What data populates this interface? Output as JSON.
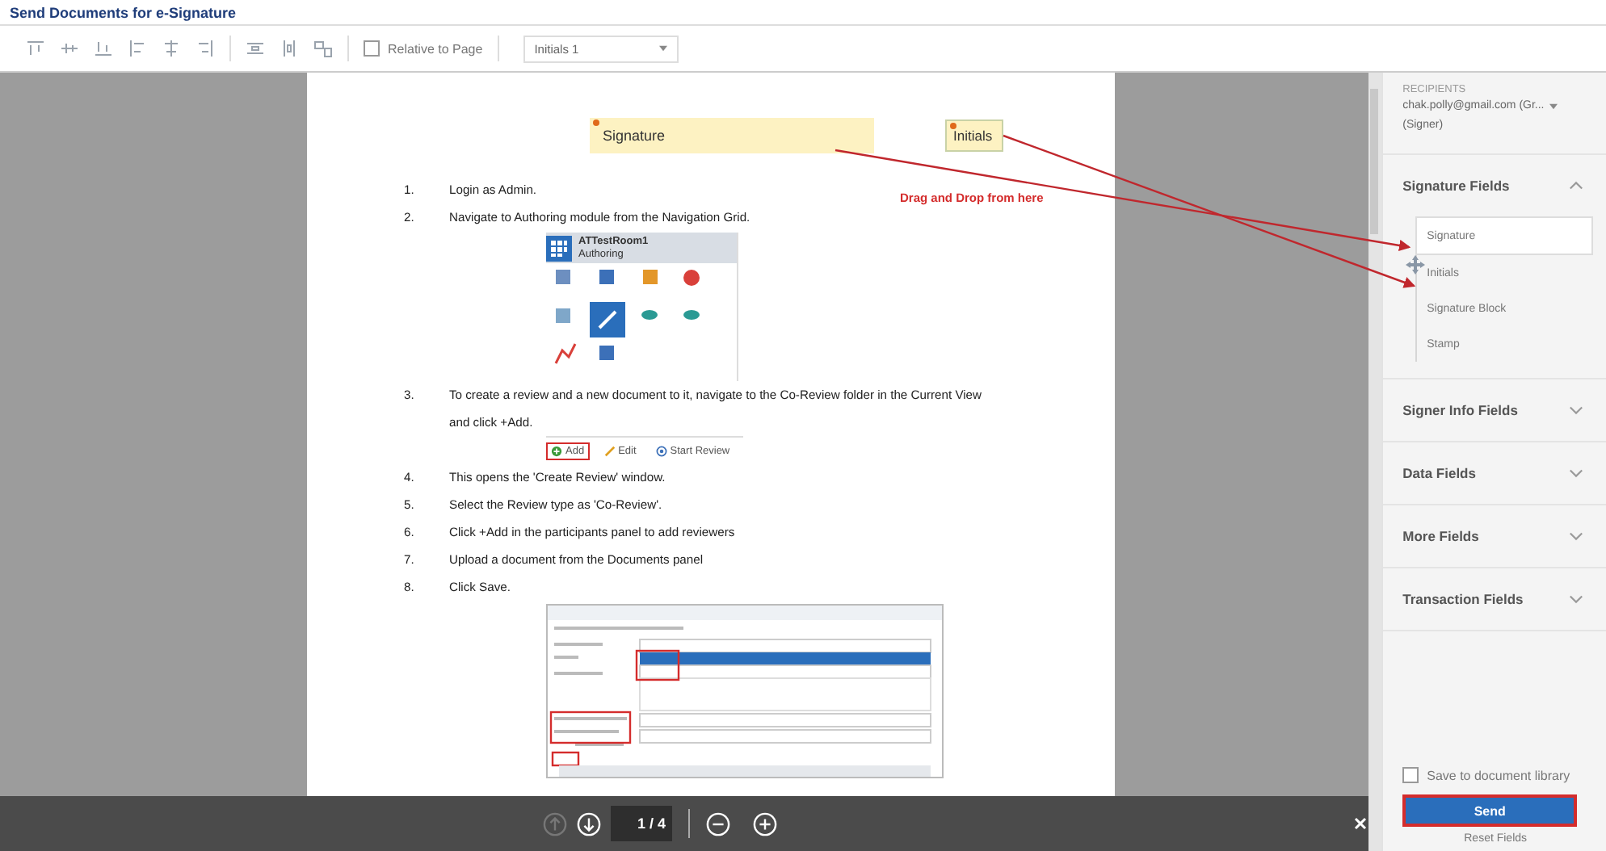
{
  "window": {
    "title": "Send Documents for e-Signature"
  },
  "toolbar": {
    "relative_to_page": {
      "label": "Relative to Page",
      "checked": false
    },
    "field_select": {
      "value": "Initials 1"
    }
  },
  "document": {
    "fields": [
      {
        "kind": "signature",
        "label": "Signature"
      },
      {
        "kind": "initials",
        "label": "Initials"
      }
    ],
    "annotation": {
      "text": "Drag and Drop from here"
    },
    "steps": [
      {
        "number": "1.",
        "text": "Login as Admin."
      },
      {
        "number": "2.",
        "text": "Navigate to Authoring module from the Navigation Grid.",
        "figure": {
          "kind": "nav_grid",
          "title": "ATTestRoom1",
          "subtitle": "Authoring"
        }
      },
      {
        "number": "3.",
        "text": "To create a review and a new document to it, navigate to the Co-Review folder in the Current View and click +Add.",
        "figure": {
          "kind": "button_strip",
          "buttons": [
            {
              "kind": "add",
              "label": "Add",
              "highlighted": true
            },
            {
              "kind": "edit",
              "label": "Edit",
              "highlighted": false
            },
            {
              "kind": "start",
              "label": "Start Review",
              "highlighted": false
            }
          ]
        }
      },
      {
        "number": "4.",
        "text": "This opens the 'Create Review' window."
      },
      {
        "number": "5.",
        "text": "Select the Review type as 'Co-Review'."
      },
      {
        "number": "6.",
        "text": "Click +Add in the participants panel to add reviewers"
      },
      {
        "number": "7.",
        "text": "Upload a document from the Documents panel"
      },
      {
        "number": "8.",
        "text": "Click Save.",
        "figure": {
          "kind": "dialog"
        }
      }
    ]
  },
  "pager": {
    "page": "1 / 4"
  },
  "panel": {
    "recipients_label": "RECIPIENTS",
    "recipient": "chak.polly@gmail.com (Gr...",
    "recipient_role": "(Signer)",
    "sections": [
      {
        "title": "Signature Fields",
        "expanded": true,
        "items": [
          {
            "label": "Signature",
            "selected": true
          },
          {
            "label": "Initials",
            "selected": false
          },
          {
            "label": "Signature Block",
            "selected": false
          },
          {
            "label": "Stamp",
            "selected": false
          }
        ]
      },
      {
        "title": "Signer Info Fields",
        "expanded": false
      },
      {
        "title": "Data Fields",
        "expanded": false
      },
      {
        "title": "More Fields",
        "expanded": false
      },
      {
        "title": "Transaction Fields",
        "expanded": false
      }
    ],
    "save_to_library": {
      "label": "Save to document library",
      "checked": false
    },
    "send": {
      "label": "Send",
      "highlighted": true
    },
    "reset": "Reset Fields"
  }
}
